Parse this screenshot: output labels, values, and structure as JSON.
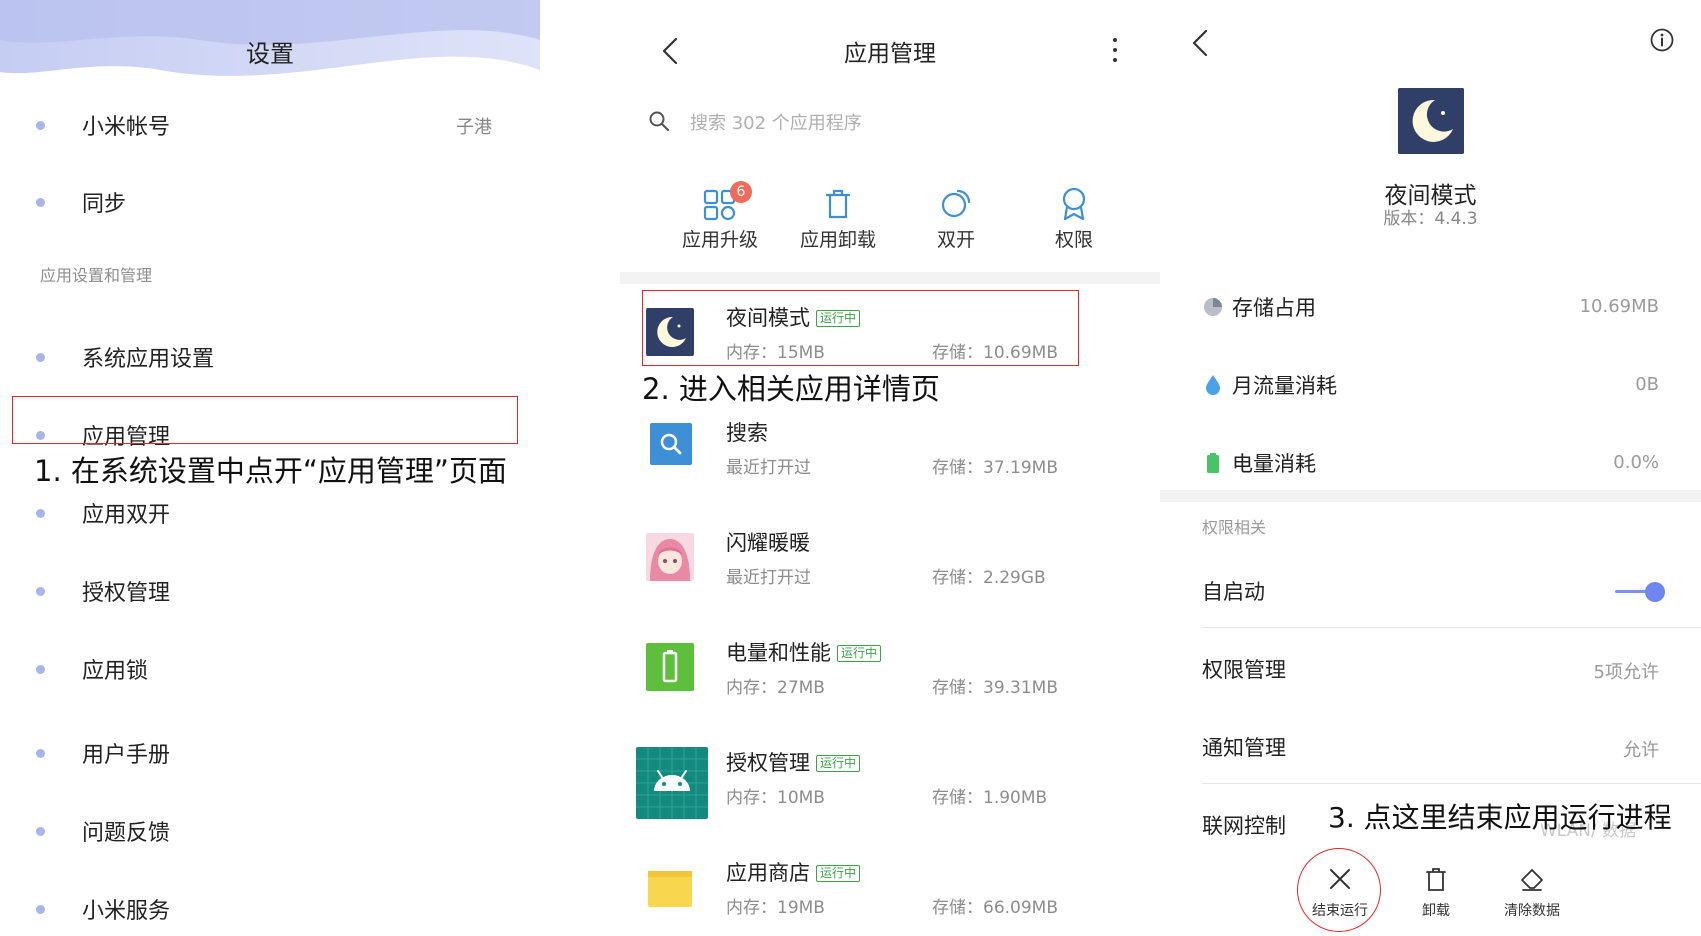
{
  "panel1": {
    "title": "设置",
    "items": [
      {
        "label": "小米帐号",
        "value": "子港"
      },
      {
        "label": "同步",
        "value": ""
      },
      {
        "label": "系统应用设置",
        "value": ""
      },
      {
        "label": "应用管理",
        "value": ""
      },
      {
        "label": "应用双开",
        "value": ""
      },
      {
        "label": "授权管理",
        "value": ""
      },
      {
        "label": "应用锁",
        "value": ""
      },
      {
        "label": "用户手册",
        "value": ""
      },
      {
        "label": "问题反馈",
        "value": ""
      },
      {
        "label": "小米服务",
        "value": ""
      }
    ],
    "section_label": "应用设置和管理",
    "annotation": "1. 在系统设置中点开“应用管理”页面",
    "dot_color": "#a9b4ea"
  },
  "panel2": {
    "title": "应用管理",
    "search_placeholder": "搜索 302 个应用程序",
    "quick_actions": [
      {
        "label": "应用升级",
        "badge": "6",
        "icon": "apps-grid-icon"
      },
      {
        "label": "应用卸载",
        "icon": "trash-icon"
      },
      {
        "label": "双开",
        "icon": "dual-circle-icon"
      },
      {
        "label": "权限",
        "icon": "badge-ribbon-icon"
      }
    ],
    "apps": [
      {
        "name": "夜间模式",
        "running": "运行中",
        "mem": "内存：15MB",
        "storage": "存储：10.69MB",
        "icon": "moon-icon"
      },
      {
        "name": "搜索",
        "running": "",
        "mem": "最近打开过",
        "storage": "存储：37.19MB",
        "icon": "search-app-icon"
      },
      {
        "name": "闪耀暖暖",
        "running": "",
        "mem": "最近打开过",
        "storage": "存储：2.29GB",
        "icon": "game-avatar-icon"
      },
      {
        "name": "电量和性能",
        "running": "运行中",
        "mem": "内存：27MB",
        "storage": "存储：39.31MB",
        "icon": "battery-app-icon"
      },
      {
        "name": "授权管理",
        "running": "运行中",
        "mem": "内存：10MB",
        "storage": "存储：1.90MB",
        "icon": "android-icon"
      },
      {
        "name": "应用商店",
        "running": "运行中",
        "mem": "内存：19MB",
        "storage": "存储：66.09MB",
        "icon": "shopping-bag-icon"
      }
    ],
    "annotation": "2. 进入相关应用详情页",
    "accent": "#3d8fd6"
  },
  "panel3": {
    "app_name": "夜间模式",
    "version": "版本：4.4.3",
    "stats": [
      {
        "label": "存储占用",
        "value": "10.69MB",
        "icon": "pie-icon"
      },
      {
        "label": "月流量消耗",
        "value": "0B",
        "icon": "drop-icon"
      },
      {
        "label": "电量消耗",
        "value": "0.0%",
        "icon": "battery-icon"
      }
    ],
    "section_label": "权限相关",
    "settings": [
      {
        "label": "自启动",
        "value": "",
        "toggle_on": true
      },
      {
        "label": "权限管理",
        "value": "5项允许"
      },
      {
        "label": "通知管理",
        "value": "允许"
      },
      {
        "label": "联网控制",
        "value": ""
      }
    ],
    "partial_text": "WLAN/ 数据",
    "annotation": "3. 点这里结束应用运行进程",
    "bottom_actions": [
      {
        "label": "结束运行",
        "icon": "close-icon"
      },
      {
        "label": "卸载",
        "icon": "trash-icon"
      },
      {
        "label": "清除数据",
        "icon": "eraser-icon"
      }
    ],
    "highlight_color": "#e8272a"
  }
}
